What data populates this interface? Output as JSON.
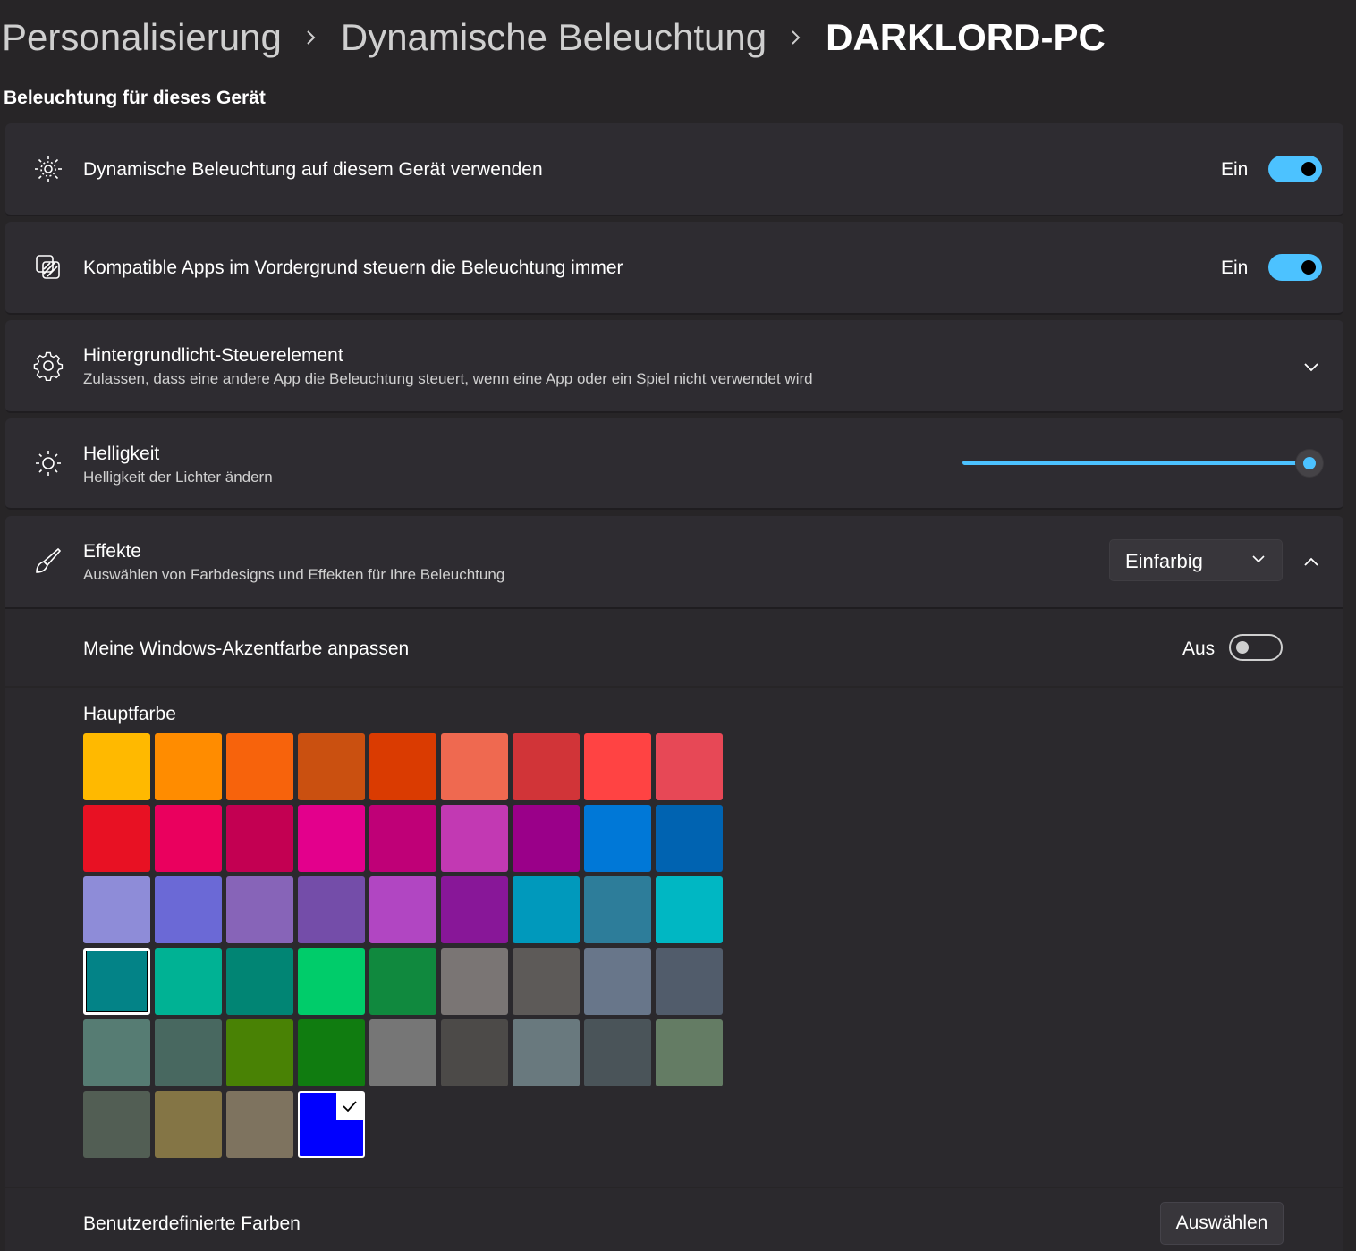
{
  "breadcrumb": {
    "items": [
      "Personalisierung",
      "Dynamische Beleuchtung"
    ],
    "current": "DARKLORD-PC"
  },
  "section_title": "Beleuchtung für dieses Gerät",
  "rows": {
    "use_dynamic": {
      "title": "Dynamische Beleuchtung auf diesem Gerät verwenden",
      "state": "Ein",
      "on": true,
      "icon": "lighting-icon"
    },
    "compatible_apps": {
      "title": "Kompatible Apps im Vordergrund steuern die Beleuchtung immer",
      "state": "Ein",
      "on": true,
      "icon": "apps-lighting-icon"
    },
    "background_control": {
      "title": "Hintergrundlicht-Steuerelement",
      "subtitle": "Zulassen, dass eine andere App die Beleuchtung steuert, wenn eine App oder ein Spiel nicht verwendet wird",
      "icon": "gear-icon"
    },
    "brightness": {
      "title": "Helligkeit",
      "subtitle": "Helligkeit der Lichter ändern",
      "value_percent": 100,
      "icon": "sun-icon"
    },
    "effects": {
      "title": "Effekte",
      "subtitle": "Auswählen von Farbdesigns und Effekten für Ihre Beleuchtung",
      "dropdown_value": "Einfarbig",
      "icon": "brush-icon"
    },
    "accent_color": {
      "title": "Meine Windows-Akzentfarbe anpassen",
      "state": "Aus",
      "on": false
    }
  },
  "main_color": {
    "label": "Hauptfarbe",
    "swatches": [
      "#FFB900",
      "#FF8C00",
      "#F7630C",
      "#CA5010",
      "#DA3B01",
      "#EF6950",
      "#D13438",
      "#FF4343",
      "#E74856",
      "#E81123",
      "#EA005E",
      "#C30052",
      "#E3008C",
      "#BF0077",
      "#C239B3",
      "#9A0089",
      "#0078D7",
      "#0063B1",
      "#8E8CD8",
      "#6B69D6",
      "#8764B8",
      "#744DA9",
      "#B146C2",
      "#881798",
      "#0099BC",
      "#2D7D9A",
      "#00B7C3",
      "#038387",
      "#00B294",
      "#018574",
      "#00CC6A",
      "#10893E",
      "#7A7574",
      "#5D5A58",
      "#68768A",
      "#515C6B",
      "#567C73",
      "#486860",
      "#498205",
      "#107C10",
      "#767676",
      "#4C4A48",
      "#69797E",
      "#4A5459",
      "#647C64",
      "#525E54",
      "#847545",
      "#7E735F",
      "#0000FF"
    ],
    "focused_index": 27,
    "selected_index": 48
  },
  "custom_colors": {
    "title": "Benutzerdefinierte Farben",
    "button_label": "Auswählen"
  }
}
